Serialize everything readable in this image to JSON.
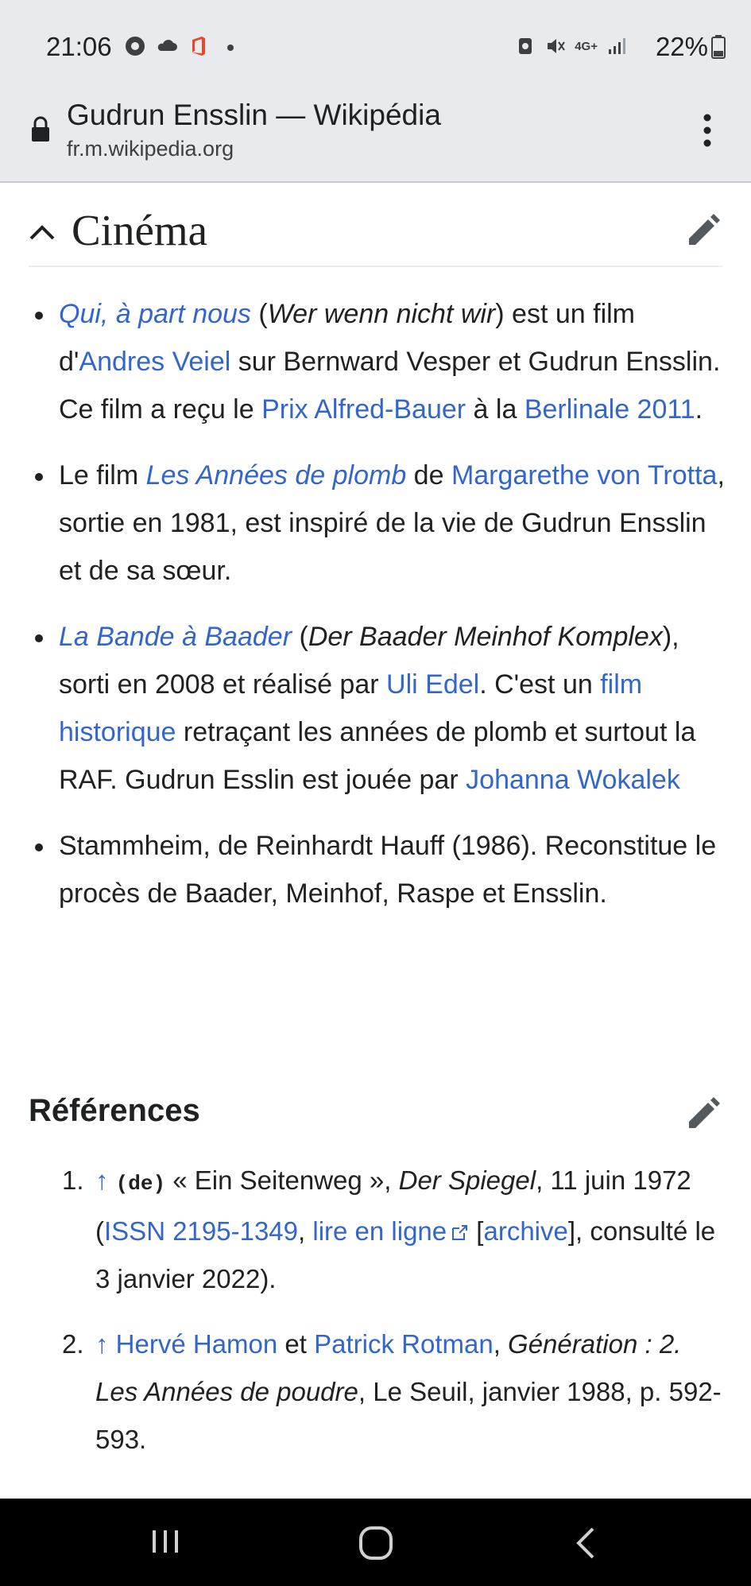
{
  "status_bar": {
    "time": "21:06",
    "battery": "22%",
    "network": "4G+"
  },
  "browser": {
    "page_title": "Gudrun Ensslin — Wikipédia",
    "domain": "fr.m.wikipedia.org"
  },
  "section": {
    "title": "Cinéma",
    "items": [
      {
        "link1": "Qui, à part nous",
        "t1": " (",
        "i1": "Wer wenn nicht wir",
        "t2": ") est un film d'",
        "link2": "Andres Veiel",
        "t3": " sur Bernward Vesper et Gudrun Ensslin. Ce film a reçu le ",
        "link3": "Prix Alfred-Bauer",
        "t4": " à la ",
        "link4": "Berlinale 2011",
        "t5": "."
      },
      {
        "t1": "Le film ",
        "link1": "Les Années de plomb",
        "t2": " de ",
        "link2": "Margarethe von Trotta",
        "t3": ", sortie en 1981, est inspiré de la vie de Gudrun Ensslin et de sa sœur."
      },
      {
        "link1": "La Bande à Baader",
        "t1": " (",
        "i1": "Der Baader Meinhof Komplex",
        "t2": "), sorti en 2008 et réalisé par ",
        "link2": "Uli Edel",
        "t3": ". C'est un ",
        "link3": "film historique",
        "t4": " retraçant les années de plomb et surtout la RAF. Gudrun Esslin est jouée par ",
        "link4": "Johanna Wokalek"
      },
      {
        "t1": "Stammheim, de Reinhardt Hauff (1986). Reconstitue le procès de Baader, Meinhof, Raspe et Ensslin."
      }
    ]
  },
  "references": {
    "title": "Références",
    "items": [
      {
        "num": "1.",
        "arrow": "↑",
        "lang": "(de)",
        "t1": " « Ein Seitenweg », ",
        "i1": "Der Spiegel",
        "t2": ", 11 juin 1972 (",
        "link1": "ISSN 2195-1349",
        "t3": ", ",
        "link2": "lire en ligne",
        "t4": " [",
        "link3": "archive",
        "t5": "], consulté le 3 janvier 2022)."
      },
      {
        "num": "2.",
        "arrow": "↑",
        "link1": "Hervé Hamon",
        "t1": " et ",
        "link2": "Patrick Rotman",
        "t2": ", ",
        "i1": "Génération : 2. Les Années de poudre",
        "t3": ", Le Seuil, janvier 1988, p. 592-593."
      }
    ]
  }
}
